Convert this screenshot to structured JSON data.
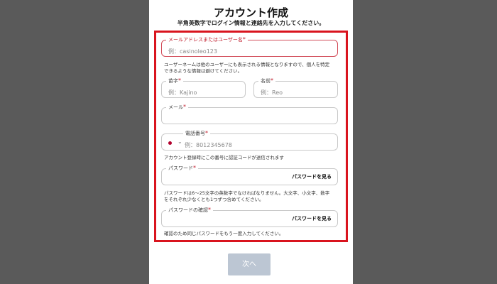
{
  "header": {
    "title": "アカウント作成",
    "subtitle": "半角英数字でログイン情報と連絡先を入力してください。"
  },
  "form": {
    "username": {
      "label": "メールアドレスまたはユーザー名",
      "star": "*",
      "placeholder": "例：casinoleo123"
    },
    "username_note_1": "ユーザーネームは他のユーザーにも表示される情報となりますので、個人を特定",
    "username_note_2": "できるような情報は避けてください。",
    "last_name": {
      "label": "苗字",
      "star": "*",
      "placeholder": "例：Kajino"
    },
    "first_name": {
      "label": "名前",
      "star": "*",
      "placeholder": "例：Reo"
    },
    "email": {
      "label": "メール",
      "star": "*",
      "placeholder": ""
    },
    "phone": {
      "label": "電話番号",
      "star": "*",
      "placeholder": "例：8012345678",
      "country_icon": "japan-flag-icon"
    },
    "phone_note": "アカウント登録時にこの番号に認証コードが送信されます",
    "password": {
      "label": "パスワード",
      "star": "*",
      "show_label": "パスワードを見る"
    },
    "password_note_1": "パスワードは6～25文字の英数字でなければなりません。大文字、小文字、数字",
    "password_note_2": "をそれぞれ少なくとも1つずつ含めてください。",
    "password_confirm": {
      "label": "パスワードの確認",
      "star": "*",
      "show_label": "パスワードを見る"
    },
    "password_confirm_note": "確認のため同じパスワードをもう一度入力してください。"
  },
  "footer": {
    "next_label": "次へ"
  },
  "colors": {
    "highlight": "#d9141e",
    "required": "#c01a2a",
    "button_disabled": "#bcc6d3"
  }
}
